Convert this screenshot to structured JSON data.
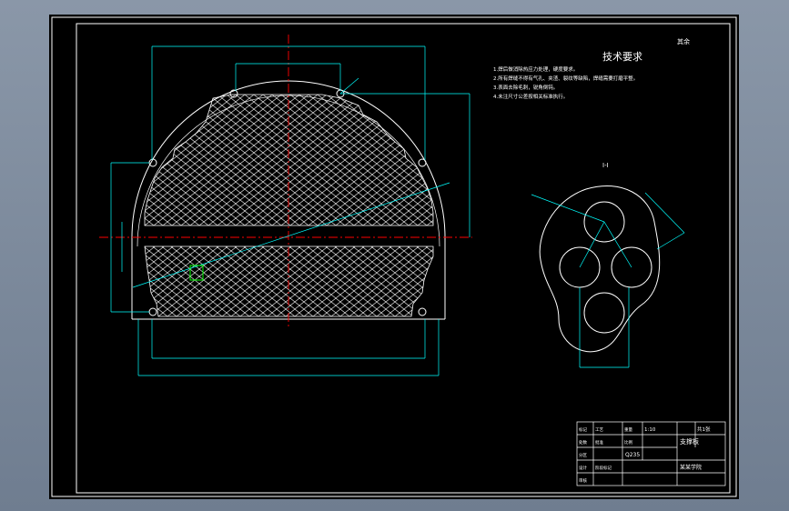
{
  "drawing": {
    "title": "技术要求",
    "corner_mark": "其余",
    "section_label": "I-I",
    "tech_notes": [
      "1.焊后做消除热应力处理，硬度要求。",
      "2.所有焊缝不得有气孔、夹渣、裂纹等缺陷，焊缝需要打磨平整。",
      "3.表面去除毛刺，锐角倒钝。",
      "4.未注尺寸公差按相关标准执行。"
    ]
  },
  "title_block": {
    "drawing_name": "支撑板",
    "company": "某某学院",
    "scale": "1:10",
    "sheet": "共1张",
    "material": "Q235",
    "labels": [
      "标记",
      "处数",
      "分区",
      "设计",
      "审核",
      "工艺",
      "批准",
      "阶段标记",
      "重量",
      "比例"
    ]
  },
  "colors": {
    "background": "#000000",
    "geometry": "#ffffff",
    "dimension": "#00ffff",
    "centerline": "#ff0000",
    "highlight": "#00ff00"
  }
}
